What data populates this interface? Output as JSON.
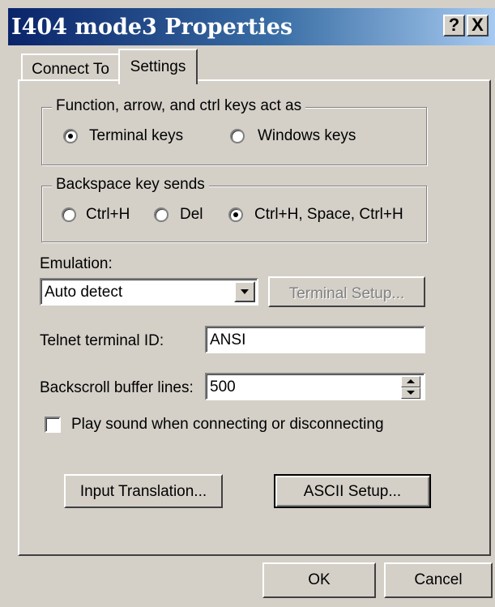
{
  "window": {
    "title": "I404 mode3 Properties",
    "help_glyph": "?",
    "close_glyph": "X"
  },
  "tabs": [
    {
      "label": "Connect To"
    },
    {
      "label": "Settings"
    }
  ],
  "keys_group": {
    "title": "Function, arrow, and ctrl keys act as",
    "options": [
      {
        "label": "Terminal keys",
        "checked": true
      },
      {
        "label": "Windows keys",
        "checked": false
      }
    ]
  },
  "backspace_group": {
    "title": "Backspace key sends",
    "options": [
      {
        "label": "Ctrl+H",
        "checked": false
      },
      {
        "label": "Del",
        "checked": false
      },
      {
        "label": "Ctrl+H, Space, Ctrl+H",
        "checked": true
      }
    ]
  },
  "emulation": {
    "label": "Emulation:",
    "value": "Auto detect",
    "terminal_setup_label": "Terminal Setup..."
  },
  "telnet": {
    "label": "Telnet terminal ID:",
    "value": "ANSI"
  },
  "backscroll": {
    "label": "Backscroll buffer lines:",
    "value": "500"
  },
  "play_sound": {
    "label": "Play sound when connecting or disconnecting",
    "checked": false
  },
  "buttons": {
    "input_translation": "Input Translation...",
    "ascii_setup": "ASCII Setup...",
    "ok": "OK",
    "cancel": "Cancel"
  }
}
